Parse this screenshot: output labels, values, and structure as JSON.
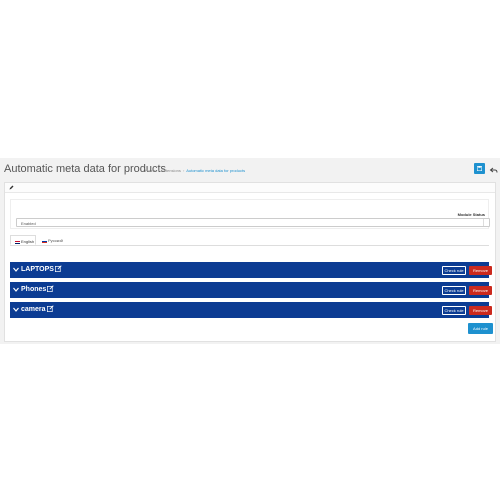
{
  "header": {
    "title": "Automatic meta data for products",
    "breadcrumb": [
      "Home",
      "Extensions",
      "Automatic meta data for products"
    ],
    "save_icon": "save-icon",
    "back_icon": "reply-icon"
  },
  "panel": {
    "heading_icon": "pencil-icon",
    "module_status_label": "Module Status",
    "module_status_value": "Enabled"
  },
  "tabs": [
    {
      "label": "English",
      "active": true
    },
    {
      "label": "Русский",
      "active": false
    }
  ],
  "rules": [
    {
      "name": "LAPTOPS",
      "check_label": "Check rule",
      "remove_label": "Remove"
    },
    {
      "name": "Phones",
      "check_label": "Check rule",
      "remove_label": "Remove"
    },
    {
      "name": "camera",
      "check_label": "Check rule",
      "remove_label": "Remove"
    }
  ],
  "add_rule_label": "Add rule",
  "colors": {
    "primary": "#1e91cf",
    "rule_bar": "#0c3c93",
    "danger": "#cc2a1e"
  }
}
